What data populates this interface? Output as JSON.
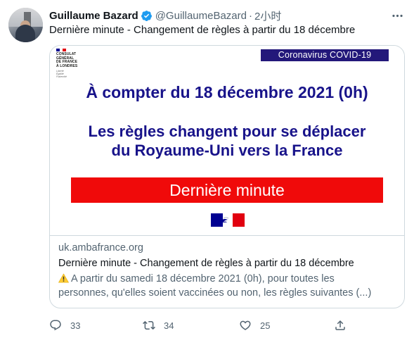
{
  "author": {
    "name": "Guillaume Bazard",
    "handle": "@GuillaumeBazard",
    "separator": "·",
    "time": "2小时"
  },
  "tweet": {
    "text": "Dernière minute - Changement de règles à partir du 18 décembre"
  },
  "card": {
    "image": {
      "consulat_title": "CONSULAT\nGÉNÉRAL\nDE FRANCE\nÀ LONDRES",
      "consulat_motto": "Liberté\nÉgalité\nFraternité",
      "badge": "Coronavirus COVID-19",
      "headline_date": "À compter du 18 décembre 2021 (0h)",
      "headline_line1": "Les règles changent pour se déplacer",
      "headline_line2": "du Royaume-Uni vers la France",
      "banner": "Dernière minute",
      "colors": {
        "navy": "#18138a",
        "badge_bg": "#23187a",
        "banner_red": "#f00a0a",
        "flag_blue": "#000091",
        "flag_red": "#e1000f"
      }
    },
    "domain": "uk.ambafrance.org",
    "title": "Dernière minute - Changement de règles à partir du 18 décembre",
    "description_line1": "A partir du samedi 18 décembre 2021 (0h), pour toutes les",
    "description_line2": "personnes, qu'elles soient vaccinées ou non, les règles suivantes (...)",
    "description_icon": "warning-icon"
  },
  "actions": {
    "reply": {
      "icon": "reply-icon",
      "count": "33"
    },
    "retweet": {
      "icon": "retweet-icon",
      "count": "34"
    },
    "like": {
      "icon": "heart-icon",
      "count": "25"
    },
    "share": {
      "icon": "share-icon",
      "count": ""
    }
  }
}
